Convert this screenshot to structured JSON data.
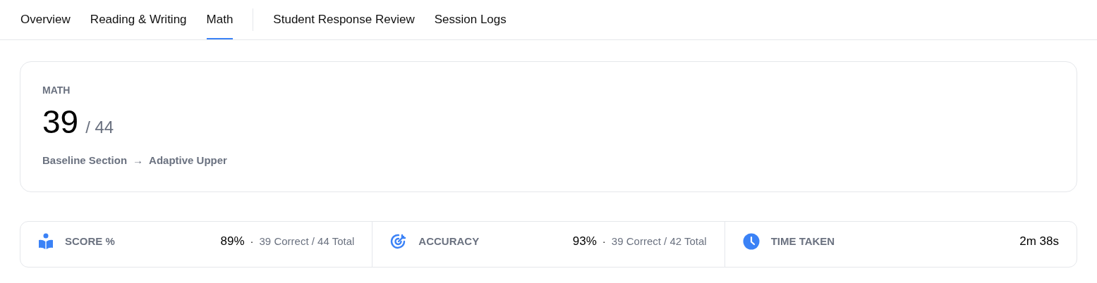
{
  "tab_groups": [
    [
      {
        "label": "Overview",
        "selected": false
      },
      {
        "label": "Reading & Writing",
        "selected": false
      },
      {
        "label": "Math",
        "selected": true
      }
    ],
    [
      {
        "label": "Student Response Review",
        "selected": false
      },
      {
        "label": "Session Logs",
        "selected": false
      }
    ]
  ],
  "section": {
    "title": "MATH",
    "score": "39",
    "total": "/ 44",
    "path_from": "Baseline Section",
    "arrow": "→",
    "path_to": "Adaptive Upper"
  },
  "metrics": [
    {
      "kind": "reader",
      "label": "SCORE %",
      "value": "89%",
      "separator": "·",
      "detail": "39 Correct / 44 Total"
    },
    {
      "kind": "target",
      "label": "ACCURACY",
      "value": "93%",
      "separator": "·",
      "detail": "39 Correct / 42 Total"
    },
    {
      "kind": "clock",
      "label": "TIME TAKEN",
      "value": "2m 38s"
    }
  ]
}
